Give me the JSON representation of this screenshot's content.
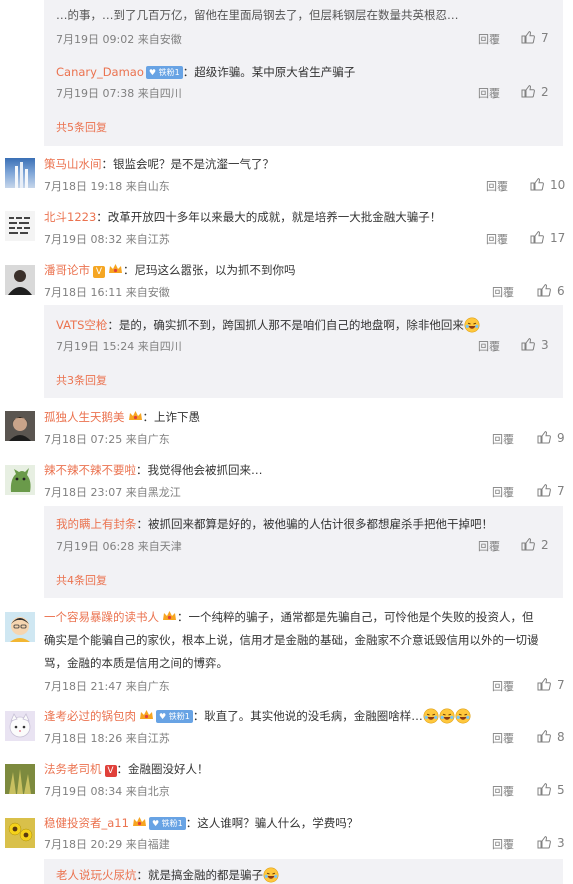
{
  "labels": {
    "reply": "回覆"
  },
  "comments": [
    {
      "top_cut_text": "…的事，…到了几百万亿，留他在里面局钢去了，但层耗钢层在数量共英根忍…",
      "replies": [
        {
          "time": "7月19日 09:02 来自安徽",
          "likes": "7"
        },
        {
          "user": "Canary_Damao",
          "badge": "铁粉1",
          "text": "：超级诈骗。某中原大省生产骗子",
          "time": "7月19日 07:38 来自四川",
          "likes": "2"
        }
      ],
      "more": "共5条回复"
    },
    {
      "user": "策马山水间",
      "text": "：银监会呢？是不是沆瀣一气了？",
      "time": "7月18日 19:18 来自山东",
      "likes": "10"
    },
    {
      "user": "北斗1223",
      "text": "：改革开放四十多年以来最大的成就，就是培养一大批金融大骗子！",
      "time": "7月19日 08:32 来自江苏",
      "likes": "17"
    },
    {
      "user": "潘哥论市",
      "text": "：尼玛这么嚣张，以为抓不到你吗",
      "time": "7月18日 16:11 来自安徽",
      "likes": "6",
      "replies": [
        {
          "user": "VATS空枪",
          "text": "：是的，确实抓不到，跨国抓人那不是咱们自己的地盘啊，除非他回来",
          "time": "7月19日 15:24 来自四川",
          "likes": "3"
        }
      ],
      "more": "共3条回复"
    },
    {
      "user": "孤独人生天鹅美",
      "text": "：上诈下愚",
      "time": "7月18日 07:25 来自广东",
      "likes": "9"
    },
    {
      "user": "辣不辣不辣不要啦",
      "text": "：我觉得他会被抓回来…",
      "time": "7月18日 23:07 来自黑龙江",
      "likes": "7",
      "replies": [
        {
          "user": "我的瞒上有封条",
          "text": "：被抓回来都算是好的，被他骗的人估计很多都想雇杀手把他干掉吧！",
          "time": "7月19日 06:28 来自天津",
          "likes": "2"
        }
      ],
      "more": "共4条回复"
    },
    {
      "user": "一个容易暴躁的读书人",
      "text_line1": "：一个纯粹的骗子，通常都是先骗自己，可怜他是个失败的投资人，但",
      "text_line2": "确实是个能骗自己的家伙，根本上说，信用才是金融的基础，金融家不介意诋毁信用以外的一切谩",
      "text_line3": "骂，金融的本质是信用之间的博弈。",
      "time": "7月18日 21:47 来自广东",
      "likes": "7"
    },
    {
      "user": "逢考必过的锅包肉",
      "badge": "铁粉1",
      "text": "：耿直了。其实他说的没毛病，金融圈啥样…",
      "time": "7月18日 18:26 来自江苏",
      "likes": "8"
    },
    {
      "user": "法务老司机",
      "text": "：金融圈没好人！",
      "time": "7月19日 08:34 来自北京",
      "likes": "5"
    },
    {
      "user": "稳健投资者_a11",
      "badge": "铁粉1",
      "text": "：这人谁啊？骗人什么，学费吗？",
      "time": "7月18日 20:29 来自福建",
      "likes": "3"
    },
    {
      "replies": [
        {
          "user": "老人说玩火尿炕",
          "text": "：就是搞金融的都是骗子"
        }
      ]
    }
  ],
  "colors": {
    "link": "#eb7350",
    "meta": "#808080",
    "reply_bg": "#f2f2f5",
    "badge": "#68a3e4"
  }
}
